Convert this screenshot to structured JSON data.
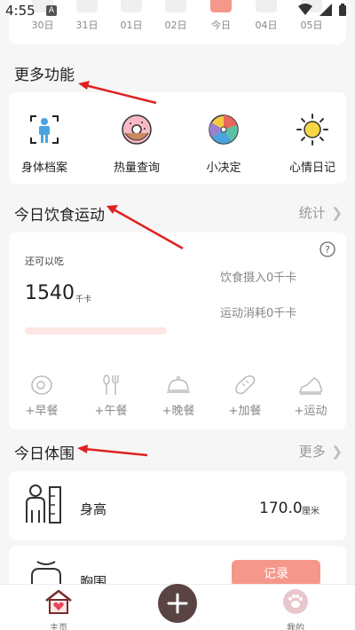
{
  "status_bar": {
    "time": "4:55",
    "notification_icon": "A"
  },
  "date_strip": {
    "days": [
      {
        "label": "30日",
        "active": false
      },
      {
        "label": "31日",
        "active": false
      },
      {
        "label": "01日",
        "active": false
      },
      {
        "label": "02日",
        "active": false
      },
      {
        "label": "今日",
        "active": true
      },
      {
        "label": "04日",
        "active": false
      },
      {
        "label": "05日",
        "active": false
      }
    ]
  },
  "more_features": {
    "title": "更多功能",
    "items": [
      {
        "label": "身体档案",
        "icon": "body-profile-icon"
      },
      {
        "label": "热量查询",
        "icon": "donut-icon"
      },
      {
        "label": "小决定",
        "icon": "spinner-wheel-icon"
      },
      {
        "label": "心情日记",
        "icon": "sun-icon"
      }
    ]
  },
  "diet_exercise": {
    "title": "今日饮食运动",
    "stats_link": "统计",
    "remaining_label": "还可以吃",
    "remaining_kcal": "1540",
    "kcal_unit": "千卡",
    "intake_text": "饮食摄入0千卡",
    "burn_text": "运动消耗0千卡",
    "progress_fraction": 0,
    "meals": [
      {
        "label": "+早餐",
        "icon": "egg-icon"
      },
      {
        "label": "+午餐",
        "icon": "fork-spoon-icon"
      },
      {
        "label": "+晚餐",
        "icon": "cloche-icon"
      },
      {
        "label": "+加餐",
        "icon": "bread-icon"
      },
      {
        "label": "+运动",
        "icon": "sneaker-icon"
      }
    ]
  },
  "body_measure": {
    "title": "今日体围",
    "more_link": "更多",
    "height_label": "身高",
    "height_value": "170.0",
    "height_unit": "厘米",
    "chest_label": "胸围",
    "record_button": "记录"
  },
  "bottom_nav": {
    "home_label": "主页",
    "me_label": "我的"
  },
  "colors": {
    "accent": "#f5978a",
    "add_button": "#5a4343",
    "annotation_arrow": "#e02020"
  }
}
